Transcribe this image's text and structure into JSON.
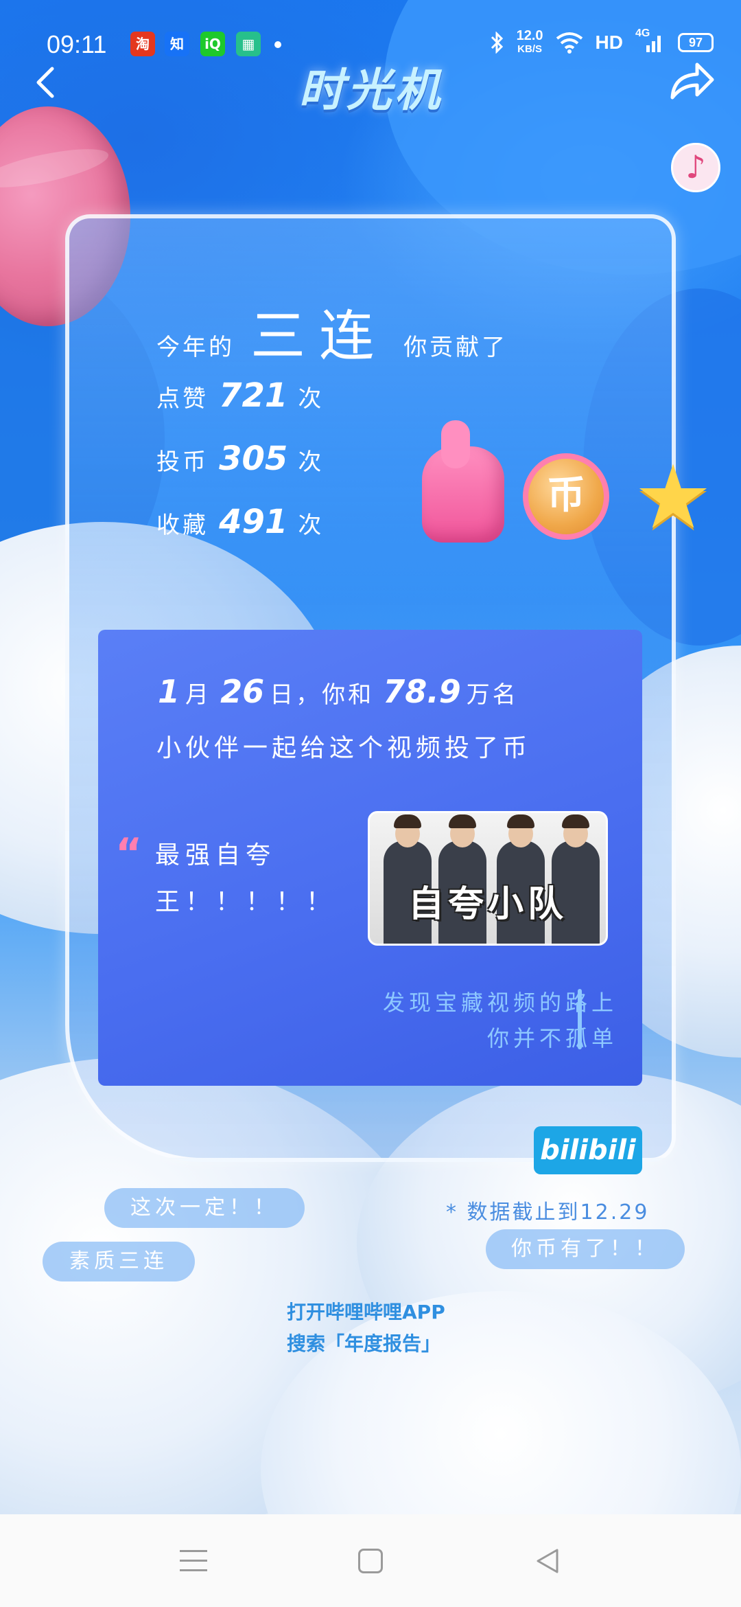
{
  "status_bar": {
    "time": "09:11",
    "notification_apps": [
      "taobao-icon",
      "zhihu-icon",
      "iqiyi-icon",
      "app-icon"
    ],
    "network_speed_value": "12.0",
    "network_speed_unit": "KB/S",
    "hd_label": "HD",
    "signal_label": "4G",
    "battery": "97"
  },
  "header": {
    "title": "时光机",
    "back_icon": "chevron-left-icon",
    "share_icon": "share-icon",
    "music_icon": "music-note-icon"
  },
  "stats": {
    "intro_prefix": "今年的",
    "intro_highlight": "三连",
    "intro_suffix": "你贡献了",
    "like_label": "点赞",
    "like_count": "721",
    "coin_label": "投币",
    "coin_count": "305",
    "fav_label": "收藏",
    "fav_count": "491",
    "unit": "次"
  },
  "highlight": {
    "month": "1",
    "month_unit": "月",
    "day": "26",
    "day_unit": "日，你和",
    "people_count": "78.9",
    "people_unit": "万名",
    "line2": "小伙伴一起给这个视频投了币",
    "quote_mark": "“",
    "quote_text": "最强自夸王！！！！！",
    "video_thumb_title": "自夸小队",
    "motto_line1": "发现宝藏视频的路上",
    "motto_line2": "你并不孤单"
  },
  "brand": {
    "logo_text": "bilibili"
  },
  "bubbles": [
    "这次一定！！",
    "素质三连",
    "你币有了！！"
  ],
  "data_note": "* 数据截止到12.29",
  "search_hint": {
    "line1": "打开哔哩哔哩APP",
    "line2": "搜索「年度报告」"
  },
  "colors": {
    "accent_blue": "#1b78ef",
    "panel_blue": "#4a6ef0",
    "pink": "#ff7fb0",
    "brand_blue": "#1da6e6"
  }
}
